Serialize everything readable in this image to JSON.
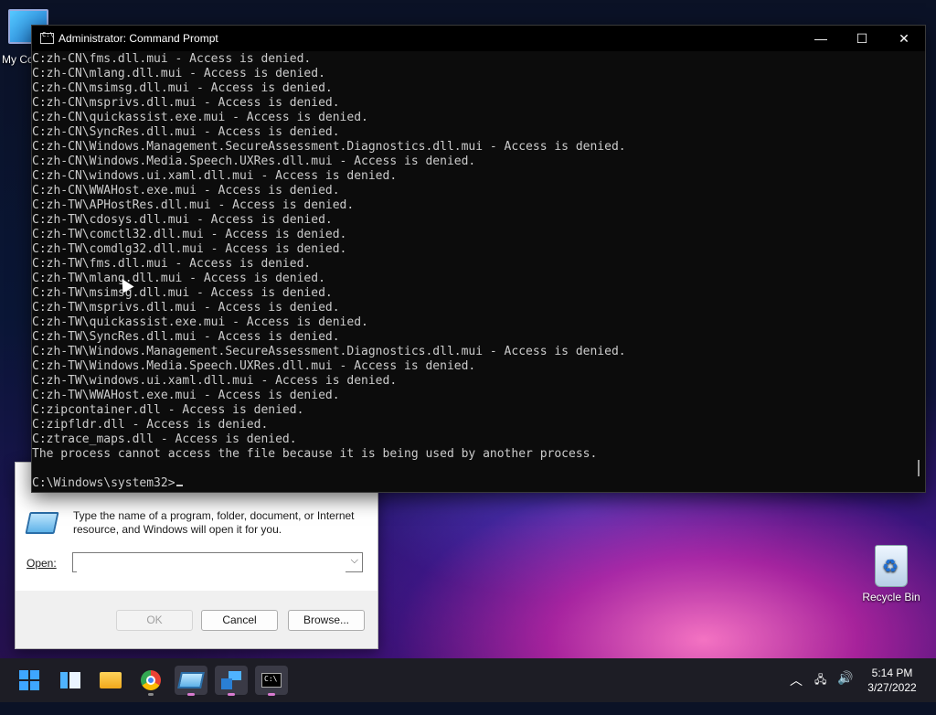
{
  "desktop": {
    "my_computer_label": "My Co",
    "recycle_bin_label": "Recycle Bin"
  },
  "cmd": {
    "title": "Administrator: Command Prompt",
    "lines": [
      "C:zh-CN\\fms.dll.mui - Access is denied.",
      "C:zh-CN\\mlang.dll.mui - Access is denied.",
      "C:zh-CN\\msimsg.dll.mui - Access is denied.",
      "C:zh-CN\\msprivs.dll.mui - Access is denied.",
      "C:zh-CN\\quickassist.exe.mui - Access is denied.",
      "C:zh-CN\\SyncRes.dll.mui - Access is denied.",
      "C:zh-CN\\Windows.Management.SecureAssessment.Diagnostics.dll.mui - Access is denied.",
      "C:zh-CN\\Windows.Media.Speech.UXRes.dll.mui - Access is denied.",
      "C:zh-CN\\windows.ui.xaml.dll.mui - Access is denied.",
      "C:zh-CN\\WWAHost.exe.mui - Access is denied.",
      "C:zh-TW\\APHostRes.dll.mui - Access is denied.",
      "C:zh-TW\\cdosys.dll.mui - Access is denied.",
      "C:zh-TW\\comctl32.dll.mui - Access is denied.",
      "C:zh-TW\\comdlg32.dll.mui - Access is denied.",
      "C:zh-TW\\fms.dll.mui - Access is denied.",
      "C:zh-TW\\mlang.dll.mui - Access is denied.",
      "C:zh-TW\\msimsg.dll.mui - Access is denied.",
      "C:zh-TW\\msprivs.dll.mui - Access is denied.",
      "C:zh-TW\\quickassist.exe.mui - Access is denied.",
      "C:zh-TW\\SyncRes.dll.mui - Access is denied.",
      "C:zh-TW\\Windows.Management.SecureAssessment.Diagnostics.dll.mui - Access is denied.",
      "C:zh-TW\\Windows.Media.Speech.UXRes.dll.mui - Access is denied.",
      "C:zh-TW\\windows.ui.xaml.dll.mui - Access is denied.",
      "C:zh-TW\\WWAHost.exe.mui - Access is denied.",
      "C:zipcontainer.dll - Access is denied.",
      "C:zipfldr.dll - Access is denied.",
      "C:ztrace_maps.dll - Access is denied.",
      "The process cannot access the file because it is being used by another process."
    ],
    "prompt": "C:\\Windows\\system32>"
  },
  "run_dialog": {
    "description": "Type the name of a program, folder, document, or Internet resource, and Windows will open it for you.",
    "open_label": "Open:",
    "open_value": "",
    "ok_label": "OK",
    "cancel_label": "Cancel",
    "browse_label": "Browse..."
  },
  "taskbar": {
    "apps": [
      "start-icon",
      "widgets-icon",
      "file-explorer-icon",
      "chrome-icon",
      "run-icon",
      "remote-desktop-icon",
      "command-prompt-icon"
    ],
    "time": "5:14 PM",
    "date": "3/27/2022"
  }
}
